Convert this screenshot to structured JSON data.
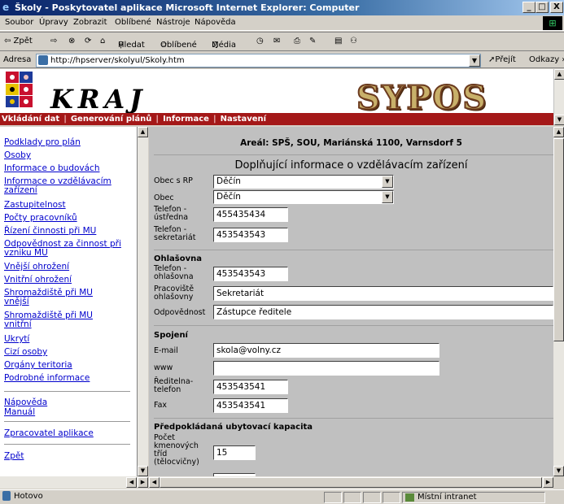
{
  "window": {
    "title": "Školy - Poskytovatel aplikace Microsoft Internet Explorer: Computer",
    "minimize": "_",
    "maximize": "□",
    "close": "X"
  },
  "menu": [
    "Soubor",
    "Úpravy",
    "Zobrazit",
    "Oblíbené",
    "Nástroje",
    "Nápověda"
  ],
  "toolbar": {
    "back": "⇦ Zpět",
    "forward": "⇨",
    "stop": "⊗",
    "refresh": "⟳",
    "home": "⌂",
    "search": "Hledat",
    "favorites": "Oblíbené",
    "media": "Média",
    "history": "◷",
    "mail": "✉",
    "print": "⎙",
    "edit": "✎",
    "discuss": "▤",
    "messenger": "⚇"
  },
  "address": {
    "label": "Adresa",
    "url": "http://hpserver/skolyul/Skoly.htm",
    "go": "Přejít",
    "links": "Odkazy »"
  },
  "header": {
    "kraj": "KRAJ",
    "sypos": "SYPOS",
    "nav": [
      "Vkládání dat",
      "Generování plánů",
      "Informace",
      "Nastavení"
    ]
  },
  "left_links": [
    "Podklady pro plán",
    "Osoby",
    "Informace o budovách",
    "Informace o vzdělávacím zařízení",
    "Zastupitelnost",
    "Počty pracovníků",
    "Řízení činnosti při MU",
    "Odpovědnost za činnost při vzniku MU",
    "Vnější ohrožení",
    "Vnitřní ohrožení",
    "Shromaždiště při MU vnější",
    "Shromaždiště při MU vnitřní",
    "Ukrytí",
    "Cizí osoby",
    "Orgány teritoria",
    "Podrobné informace",
    "Nápověda",
    "Manuál",
    "Zpracovatel aplikace",
    "Zpět"
  ],
  "content": {
    "areal": "Areál: SPŠ, SOU, Mariánská 1100, Varnsdorf 5",
    "heading": "Doplňující informace o vzdělávacím zařízení",
    "obec_rp_label": "Obec s RP",
    "obec_rp_value": "Děčín",
    "obec_label": "Obec",
    "obec_value": "Děčín",
    "tel_ustredna_label": "Telefon - ústředna",
    "tel_ustredna_value": "455435434",
    "tel_sekretariat_label": "Telefon - sekretariát",
    "tel_sekretariat_value": "453543543",
    "ohlasovna_section": "Ohlašovna",
    "tel_ohlasovna_label": "Telefon - ohlašovna",
    "tel_ohlasovna_value": "453543543",
    "pracoviste_label": "Pracoviště ohlašovny",
    "pracoviste_value": "Sekretariát",
    "odpovednost_label": "Odpovědnost",
    "odpovednost_value": "Zástupce ředitele",
    "spojeni_section": "Spojení",
    "email_label": "E-mail",
    "email_value": "skola@volny.cz",
    "www_label": "www",
    "www_value": "",
    "reditelna_label": "Ředitelna-telefon",
    "reditelna_value": "453543541",
    "fax_label": "Fax",
    "fax_value": "453543541",
    "kapacita_section": "Předpokládaná ubytovací kapacita",
    "trid_label": "Počet kmenových tříd (tělocvičny)",
    "trid_value": "15"
  },
  "status": {
    "text": "Hotovo",
    "zone": "Místní intranet"
  }
}
